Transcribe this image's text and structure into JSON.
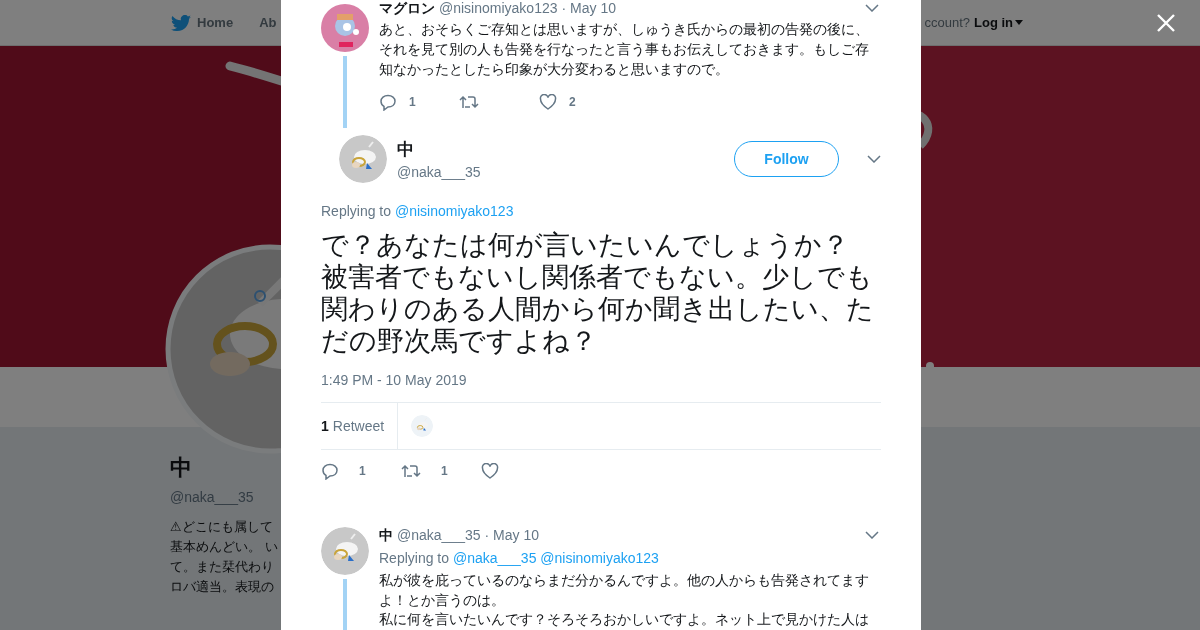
{
  "background_page": {
    "nav": {
      "home": "Home",
      "about": "Ab",
      "account_prompt": "ccount?",
      "login": "Log in"
    },
    "profile": {
      "name": "中",
      "handle": "@naka___35",
      "bio_lines": [
        "⚠どこにも属して",
        "基本めんどい。 い",
        "て。また栞代わり",
        "ロバ適当。表現の"
      ]
    }
  },
  "modal": {
    "parent_tweet": {
      "name": "マグロン",
      "handle": "@nisinomiyako123",
      "date": "· May 10",
      "text": [
        "あと、おそらくご存知とは思いますが、しゅうき氏からの最初の告発の後に、それを見て別の人も告発を行なったと言う事もお伝えしておきます。もしご存知なかったとしたら印象が大分変わると思いますので。"
      ],
      "actions": [
        {
          "kind": "reply",
          "count": "1"
        },
        {
          "kind": "retweet"
        },
        {
          "kind": "like",
          "count": "2"
        }
      ]
    },
    "main_tweet": {
      "name": "中",
      "handle": "@naka___35",
      "follow": "Follow",
      "replying_label": "Replying to",
      "replying_to": [
        "@nisinomiyako123"
      ],
      "text": [
        "で？あなたは何が言いたいんでしょうか？",
        "被害者でもないし関係者でもない。少しでも関わりのある人間から何か聞き出したい、ただの野次馬ですよね？"
      ],
      "timestamp": "1:49 PM - 10 May 2019",
      "retweet_count": "1",
      "retweet_label": "Retweet",
      "actions": [
        {
          "kind": "reply",
          "count": "1"
        },
        {
          "kind": "retweet",
          "count": "1"
        },
        {
          "kind": "like"
        }
      ]
    },
    "reply_tweet": {
      "name": "中",
      "handle": "@naka___35",
      "date": "· May 10",
      "replying_label": "Replying to",
      "replying_to": [
        "@naka___35",
        "@nisinomiyako123"
      ],
      "text": [
        "私が彼を庇っているのならまだ分かるんですよ。他の人からも告発されてますよ！とか言うのは。",
        "私に何を言いたいんです？そろそろおかしいですよ。ネット上で見かけた人は"
      ]
    }
  }
}
